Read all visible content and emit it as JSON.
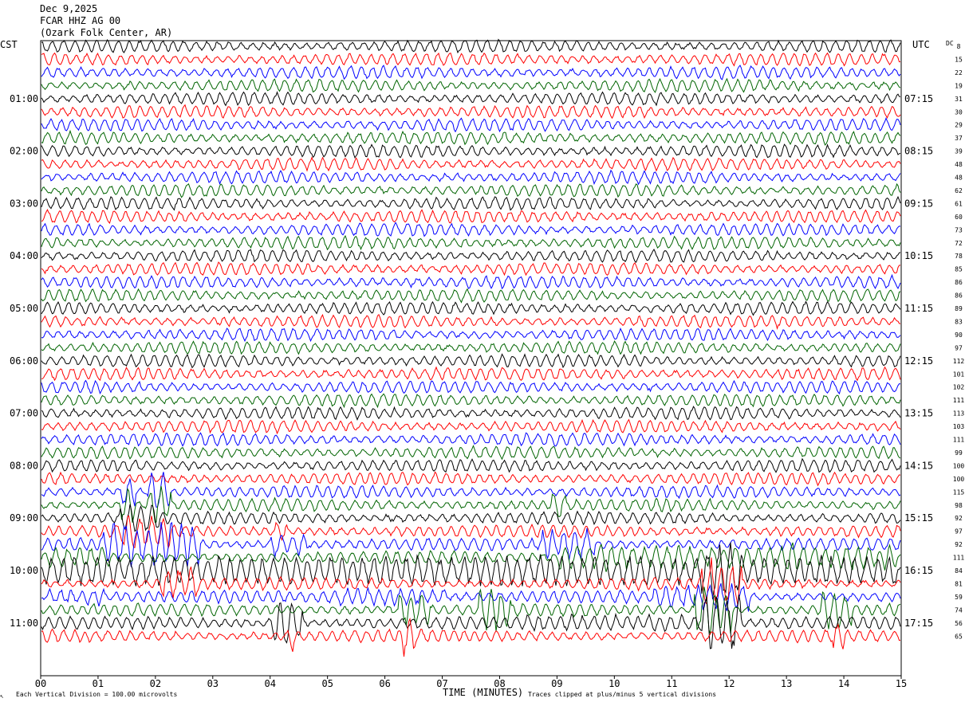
{
  "header": {
    "date": "Dec 9,2025",
    "station": "FCAR HHZ AG 00",
    "location": "(Ozark Folk Center, AR)"
  },
  "left_zone": "CST",
  "right_zone": "UTC",
  "dc_label": "DC",
  "footer": {
    "scale_note": "Each Vertical Division =  100.00 microvolts",
    "clip_note": "Traces clipped at plus/minus 5 vertical divisions",
    "corner_mark": "↖"
  },
  "colors": {
    "trace_cycle": [
      "#000000",
      "#ff0000",
      "#0000ff",
      "#006400"
    ]
  },
  "chart_data": {
    "type": "line",
    "title": "",
    "xlabel": "TIME (MINUTES)",
    "ylabel": "",
    "xlim": [
      0,
      15
    ],
    "x_ticks": [
      "00",
      "01",
      "02",
      "03",
      "04",
      "05",
      "06",
      "07",
      "08",
      "09",
      "10",
      "11",
      "12",
      "13",
      "14",
      "15"
    ],
    "left_hour_labels": [
      {
        "row": 4,
        "label": "01:00"
      },
      {
        "row": 8,
        "label": "02:00"
      },
      {
        "row": 12,
        "label": "03:00"
      },
      {
        "row": 16,
        "label": "04:00"
      },
      {
        "row": 20,
        "label": "05:00"
      },
      {
        "row": 24,
        "label": "06:00"
      },
      {
        "row": 28,
        "label": "07:00"
      },
      {
        "row": 32,
        "label": "08:00"
      },
      {
        "row": 36,
        "label": "09:00"
      },
      {
        "row": 40,
        "label": "10:00"
      },
      {
        "row": 44,
        "label": "11:00"
      }
    ],
    "right_hour_labels": [
      {
        "row": 4,
        "label": "07:15"
      },
      {
        "row": 8,
        "label": "08:15"
      },
      {
        "row": 12,
        "label": "09:15"
      },
      {
        "row": 16,
        "label": "10:15"
      },
      {
        "row": 20,
        "label": "11:15"
      },
      {
        "row": 24,
        "label": "12:15"
      },
      {
        "row": 28,
        "label": "13:15"
      },
      {
        "row": 32,
        "label": "14:15"
      },
      {
        "row": 36,
        "label": "15:15"
      },
      {
        "row": 40,
        "label": "16:15"
      },
      {
        "row": 44,
        "label": "17:15"
      }
    ],
    "dc_offsets": [
      8,
      15,
      22,
      19,
      31,
      30,
      29,
      37,
      39,
      48,
      48,
      62,
      61,
      60,
      73,
      72,
      78,
      85,
      86,
      86,
      89,
      83,
      90,
      97,
      112,
      101,
      102,
      111,
      113,
      103,
      111,
      99,
      100,
      100,
      115,
      98,
      92,
      97,
      92,
      111,
      84,
      81,
      59,
      74,
      56,
      65
    ],
    "rows": 46
  }
}
